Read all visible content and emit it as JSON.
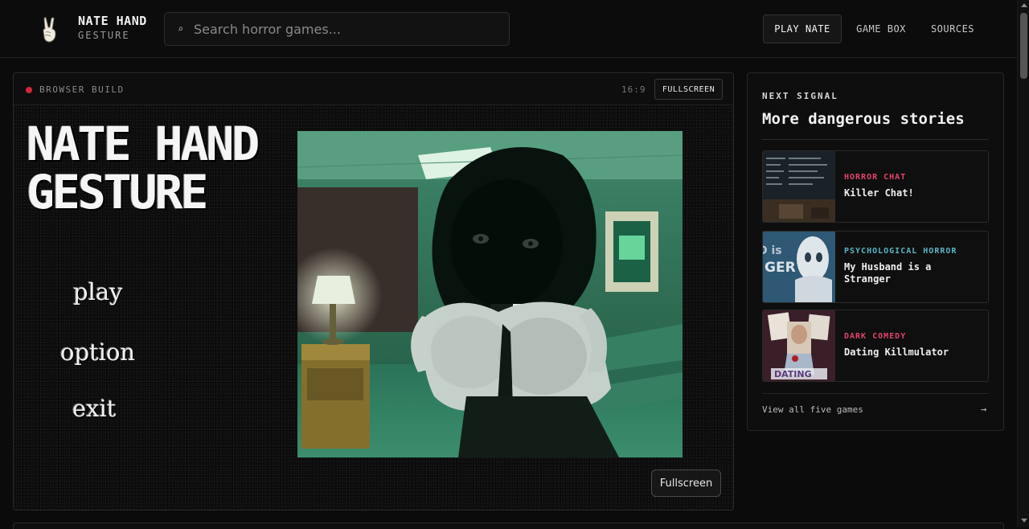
{
  "header": {
    "brand_title": "NATE HAND",
    "brand_subtitle": "GESTURE",
    "logo_icon": "peace-hand-icon",
    "search_placeholder": "Search horror games...",
    "search_icon": "search-icon",
    "nav": [
      {
        "label": "PLAY NATE",
        "active": true
      },
      {
        "label": "GAME BOX",
        "active": false
      },
      {
        "label": "SOURCES",
        "active": false
      }
    ]
  },
  "player": {
    "status_label": "BROWSER BUILD",
    "status_color": "#d2263a",
    "aspect_ratio": "16:9",
    "fullscreen_top_label": "FULLSCREEN",
    "game": {
      "title_line1": "NATE HAND",
      "title_line2": "GESTURE",
      "menu": [
        "play",
        "option",
        "exit"
      ],
      "scene_palette": [
        "#2f6b55",
        "#5fa889",
        "#c4c4c4"
      ]
    },
    "fullscreen_bottom_label": "Fullscreen"
  },
  "sidebar": {
    "kicker": "NEXT SIGNAL",
    "heading": "More dangerous stories",
    "cards": [
      {
        "genre": "HORROR CHAT",
        "genre_color": "#e0446a",
        "title": "Killer Chat!"
      },
      {
        "genre": "PSYCHOLOGICAL HORROR",
        "genre_color": "#5bb3c4",
        "title": "My Husband is a Stranger"
      },
      {
        "genre": "DARK COMEDY",
        "genre_color": "#e0446a",
        "title": "Dating Killmulator"
      }
    ],
    "view_all_label": "View all five games",
    "view_all_arrow": "→"
  }
}
